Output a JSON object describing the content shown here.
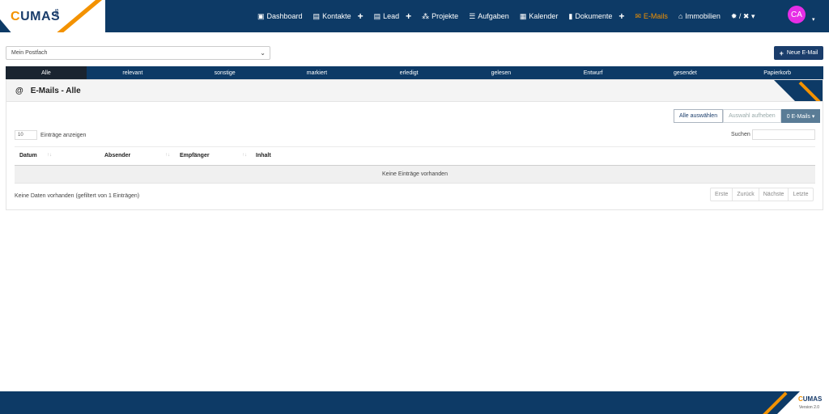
{
  "brand": {
    "logo_prefix": "C",
    "logo_rest": "UMAS",
    "logo_sub": "365",
    "accent": "#f39200",
    "primary": "#0d3a66"
  },
  "nav": {
    "items": [
      {
        "label": "Dashboard",
        "icon": "dashboard-icon",
        "glyph": "▣"
      },
      {
        "label": "Kontakte",
        "icon": "contacts-icon",
        "glyph": "▤",
        "plus": "+"
      },
      {
        "label": "Lead",
        "icon": "lead-icon",
        "glyph": "▤",
        "plus": "+"
      },
      {
        "label": "Projekte",
        "icon": "projects-icon",
        "glyph": "⁂"
      },
      {
        "label": "Aufgaben",
        "icon": "tasks-icon",
        "glyph": "☰"
      },
      {
        "label": "Kalender",
        "icon": "calendar-icon",
        "glyph": "▦"
      },
      {
        "label": "Dokumente",
        "icon": "documents-icon",
        "glyph": "▮",
        "plus": "+"
      },
      {
        "label": "E-Mails",
        "icon": "mail-icon",
        "glyph": "✉",
        "active": true
      },
      {
        "label": "Immobilien",
        "icon": "home-icon",
        "glyph": "⌂"
      }
    ],
    "settings_glyph": "✹ / ✖ ▾",
    "avatar": "CA",
    "avatar_color": "#e62ee6"
  },
  "mailbox": {
    "selected": "Mein Postfach"
  },
  "new_mail": {
    "plus": "+",
    "label": "Neue E-Mail"
  },
  "tabs": [
    "Alle",
    "relevant",
    "sonstige",
    "markiert",
    "erledigt",
    "gelesen",
    "Entwurf",
    "gesendet",
    "Papierkorb"
  ],
  "panel": {
    "icon": "@",
    "title": "E-Mails - Alle"
  },
  "actions": {
    "select_all": "Alle auswählen",
    "deselect": "Auswahl aufheben",
    "count": "0 E-Mails ▾"
  },
  "table": {
    "length_value": "10",
    "length_label": "Einträge anzeigen",
    "search_label": "Suchen",
    "columns": [
      "Datum",
      "Absender",
      "Empfänger",
      "Inhalt"
    ],
    "empty": "Keine Einträge vorhanden",
    "info": "Keine Daten vorhanden (gefiltert von 1 Einträgen)"
  },
  "pager": [
    "Erste",
    "Zurück",
    "Nächste",
    "Letzte"
  ],
  "footer": {
    "logo_prefix": "C",
    "logo_rest": "UMAS",
    "version": "Version 2.0"
  }
}
